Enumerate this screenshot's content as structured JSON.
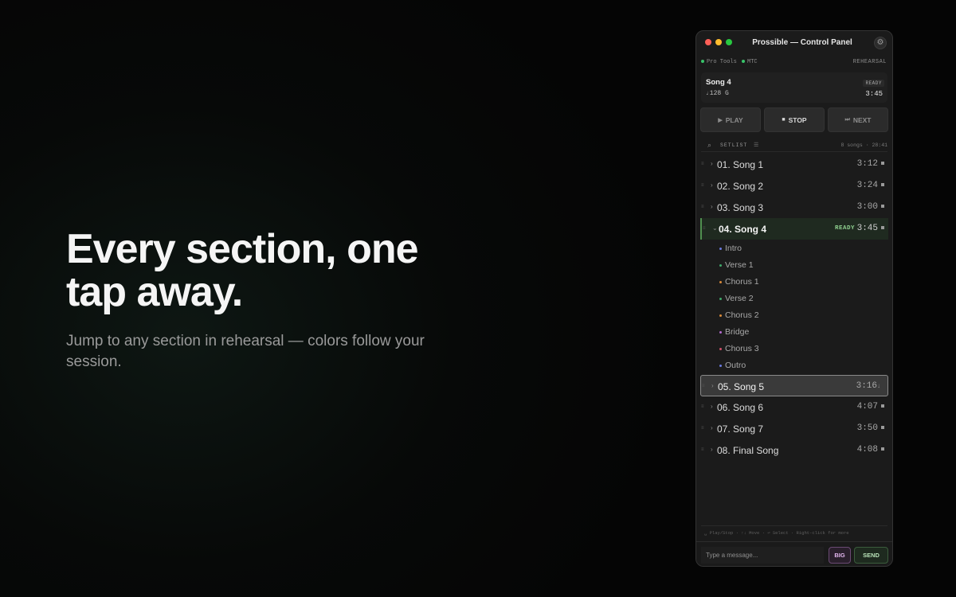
{
  "hero": {
    "title": "Every section, one tap away.",
    "subtitle": "Jump to any section in rehearsal — colors follow your session."
  },
  "window": {
    "title": "Prossible — Control Panel",
    "traffic_lights": [
      "close",
      "minimize",
      "zoom"
    ],
    "settings_icon": "gear-icon"
  },
  "status": {
    "protools": "Pro Tools",
    "mtc": "MTC",
    "mode": "REHEARSAL",
    "indicator_color": "#38c46a"
  },
  "now_playing": {
    "song": "Song 4",
    "meta": "♩128  G",
    "state": "READY",
    "duration": "3:45"
  },
  "transport": {
    "play": "PLAY",
    "stop": "STOP",
    "next": "NEXT"
  },
  "setlist": {
    "label": "SETLIST",
    "info": "8 songs · 28:41",
    "songs": [
      {
        "title": "01. Song 1",
        "duration": "3:12"
      },
      {
        "title": "02. Song 2",
        "duration": "3:24"
      },
      {
        "title": "03. Song 3",
        "duration": "3:00"
      },
      {
        "title": "04. Song 4",
        "duration": "3:45",
        "badge": "READY",
        "expanded": true
      },
      {
        "title": "05. Song 5",
        "duration": "3:16"
      },
      {
        "title": "06. Song 6",
        "duration": "4:07"
      },
      {
        "title": "07. Song 7",
        "duration": "3:50"
      },
      {
        "title": "08. Final Song",
        "duration": "4:08"
      }
    ],
    "sections": [
      {
        "name": "Intro",
        "color": "#6a7ae0"
      },
      {
        "name": "Verse 1",
        "color": "#3fa86a"
      },
      {
        "name": "Chorus 1",
        "color": "#d98a3a"
      },
      {
        "name": "Verse 2",
        "color": "#3fa86a"
      },
      {
        "name": "Chorus 2",
        "color": "#d98a3a"
      },
      {
        "name": "Bridge",
        "color": "#b46ad0"
      },
      {
        "name": "Chorus 3",
        "color": "#d0506a"
      },
      {
        "name": "Outro",
        "color": "#6a7ae0"
      }
    ]
  },
  "hints": "␣ Play/Stop · ↑↓ Move · ⏎ Select · Right-click for more",
  "message": {
    "placeholder": "Type a message...",
    "big_label": "BIG",
    "send_label": "SEND"
  }
}
